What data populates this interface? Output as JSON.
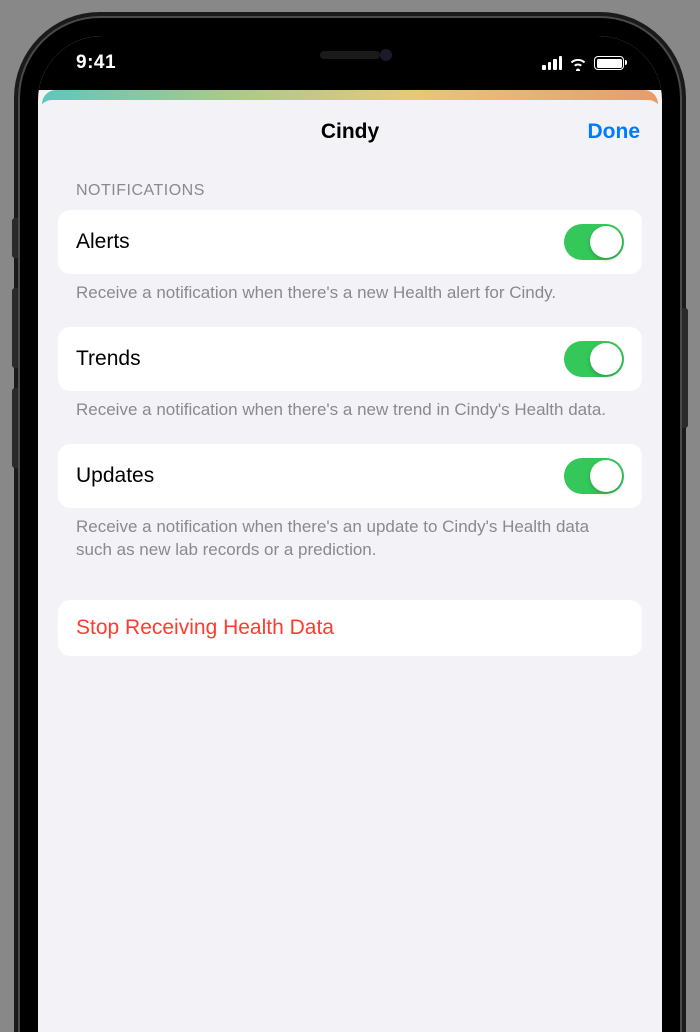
{
  "status": {
    "time": "9:41"
  },
  "nav": {
    "title": "Cindy",
    "done": "Done"
  },
  "notifications": {
    "header": "NOTIFICATIONS",
    "alerts": {
      "label": "Alerts",
      "footer": "Receive a notification when there's a new Health alert for Cindy."
    },
    "trends": {
      "label": "Trends",
      "footer": "Receive a notification when there's a new trend in Cindy's Health data."
    },
    "updates": {
      "label": "Updates",
      "footer": "Receive a notification when there's an update to Cindy's Health data such as new lab records or a prediction."
    }
  },
  "actions": {
    "stop": "Stop Receiving Health Data"
  }
}
